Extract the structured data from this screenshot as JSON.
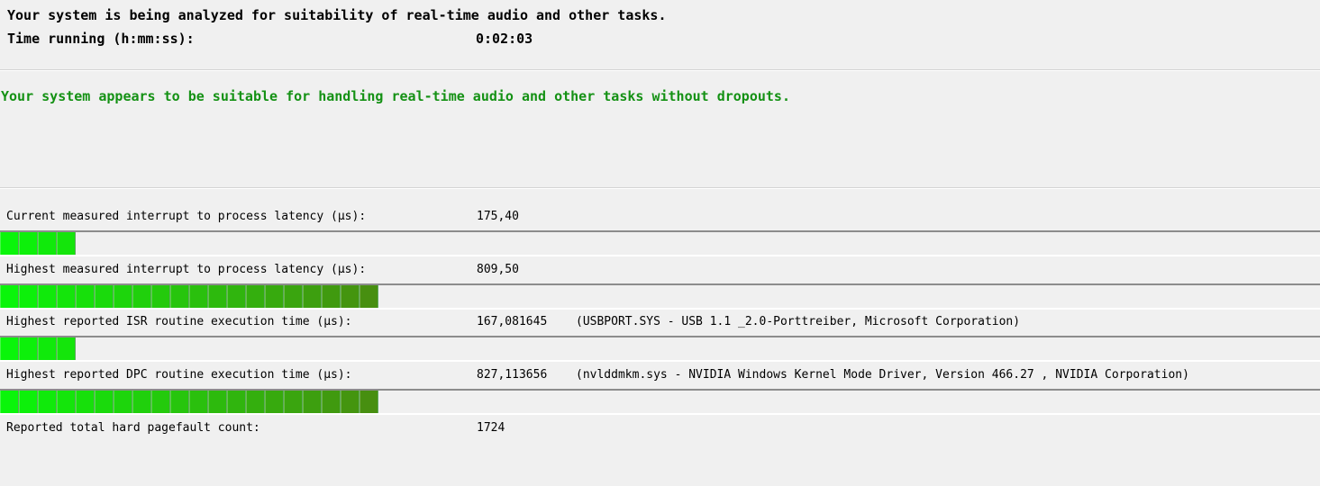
{
  "header": {
    "analyzing_text": "Your system is being analyzed for suitability of real-time audio and other tasks.",
    "time_label": "Time running (h:mm:ss):",
    "time_value": "0:02:03"
  },
  "status": {
    "message": "Your system appears to be suitable for handling real-time audio and other tasks without dropouts.",
    "color": "#149114"
  },
  "metrics": [
    {
      "label": "Current measured interrupt to process latency (µs):",
      "value": "175,40",
      "detail": "",
      "bar_fraction": 0.056
    },
    {
      "label": "Highest measured interrupt to process latency (µs):",
      "value": "809,50",
      "detail": "",
      "bar_fraction": 0.285
    },
    {
      "label": "Highest reported ISR routine execution time (µs):",
      "value": "167,081645",
      "detail": "(USBPORT.SYS - USB 1.1 _2.0-Porttreiber, Microsoft Corporation)",
      "bar_fraction": 0.059
    },
    {
      "label": "Highest reported DPC routine execution time (µs):",
      "value": "827,113656",
      "detail": "(nvlddmkm.sys - NVIDIA Windows Kernel Mode Driver, Version 466.27 , NVIDIA Corporation)",
      "bar_fraction": 0.284
    },
    {
      "label": "Reported total hard pagefault count:",
      "value": "1724",
      "detail": ""
    }
  ],
  "colors": {
    "bar_start": "#0af50a",
    "bar_end": "#4a8a10",
    "separator": "#8c8c8c"
  }
}
